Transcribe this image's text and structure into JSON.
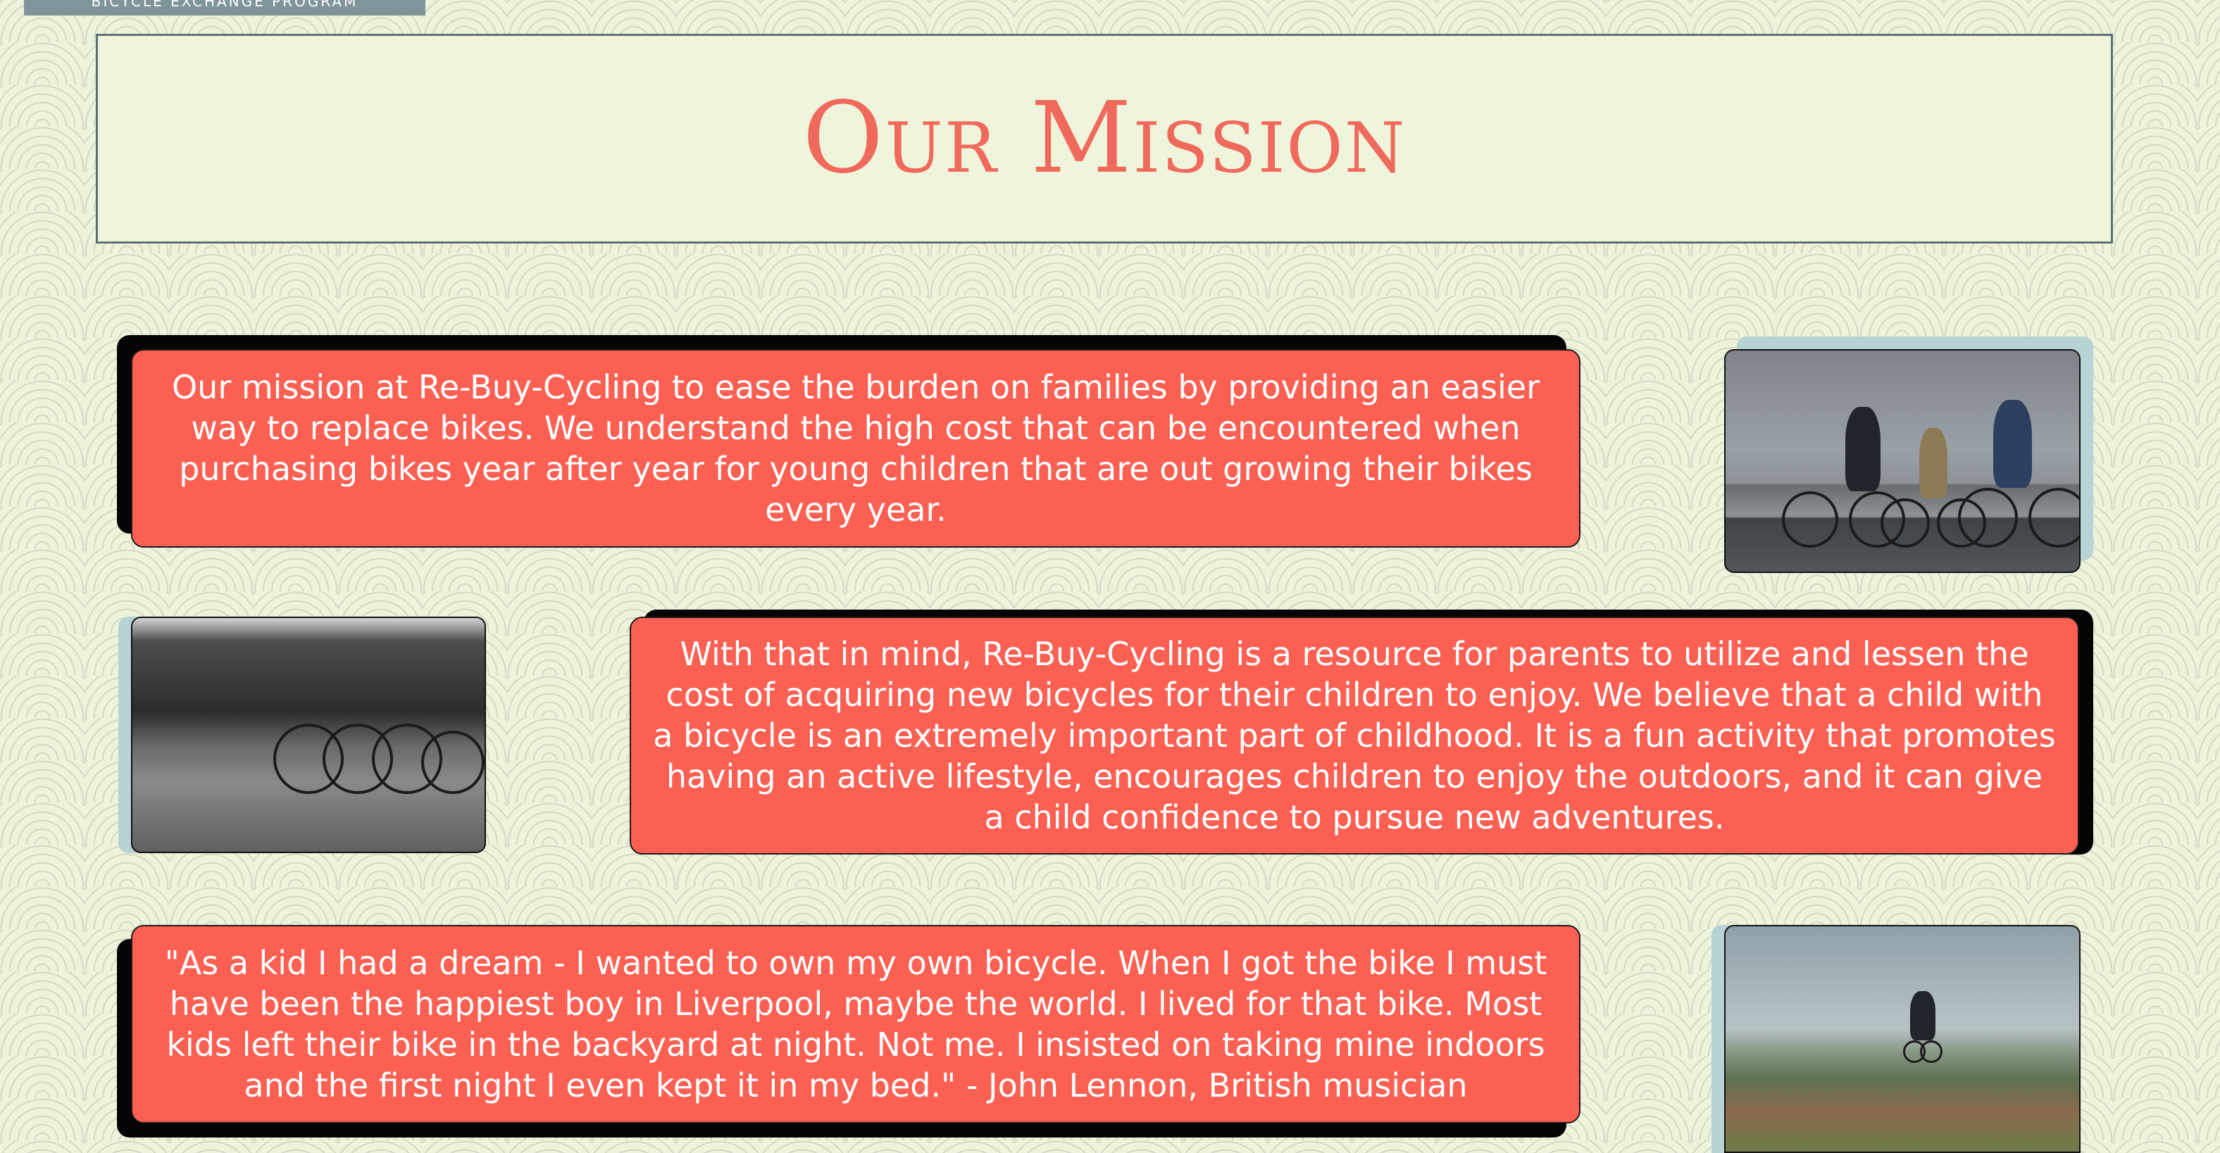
{
  "brand": {
    "tab_text": "BICYCLE EXCHANGE PROGRAM"
  },
  "hero": {
    "title": "Our Mission"
  },
  "sections": [
    {
      "text": "Our mission at Re-Buy-Cycling to ease the burden on families by providing an easier way to replace bikes. We understand the high cost that can be encountered when purchasing bikes year after year for young children that are out growing their bikes every year.",
      "image": "family-cycling-photo"
    },
    {
      "text": "With that in mind, Re-Buy-Cycling is a resource for parents to utilize and lessen the cost of acquiring new bicycles for their children to enjoy. We believe that a child with a bicycle is an extremely important part of childhood. It is a fun activity that promotes having an active lifestyle, encourages children to enjoy the outdoors, and it can give a child confidence to pursue new adventures.",
      "image": "parked-bicycles-photo"
    },
    {
      "text": "\"As a kid I had a dream - I wanted to own my own bicycle. When I got the bike I must have been the happiest boy in Liverpool, maybe the world. I lived for that bike. Most kids left their bike in the backyard at night. Not me. I insisted on taking mine indoors and the first night I even kept it in my bed.\" - John Lennon, British musician",
      "image": "bike-jump-photo"
    }
  ],
  "colors": {
    "background": "#eef3dc",
    "accent": "#fc6053",
    "title": "#ef6a5c",
    "shadow": "#050505",
    "teal": "#b7d3d3",
    "border": "#5d7174"
  }
}
